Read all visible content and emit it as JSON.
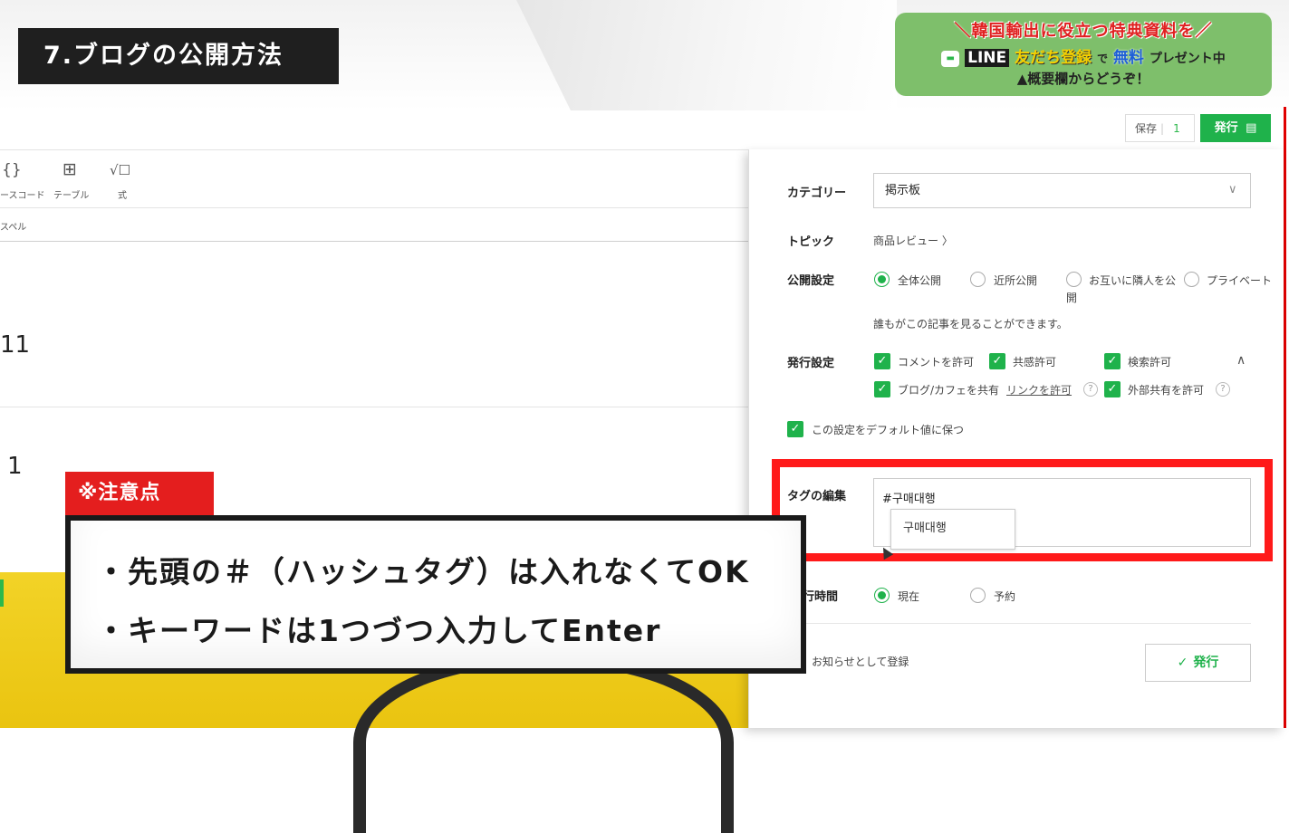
{
  "banner": {
    "section_title": "7.ブログの公開方法",
    "promo_line1": "＼韓国輸出に役立つ特典資料を／",
    "promo_line_word": "LINE",
    "promo_friends": "友だち登録",
    "promo_de": "で",
    "promo_free": "無料",
    "promo_present": "プレゼント中",
    "promo_line3": "▲概要欄からどうぞ！"
  },
  "toolbar": {
    "source_code_icon": "{}",
    "source_code_label": "ースコード",
    "table_icon": "⊞",
    "table_label": "テーブル",
    "formula_icon": "√☐",
    "formula_label": "式",
    "spell_label": "スペル"
  },
  "editor": {
    "text_1": "11",
    "text_2": "1"
  },
  "top_actions": {
    "save_label": "保存",
    "save_count": "1",
    "publish_label": "発行",
    "publish_icon": "▤"
  },
  "panel": {
    "category_label": "カテゴリー",
    "category_value": "掲示板",
    "topic_label": "トピック",
    "topic_value": "商品レビュー 〉",
    "visibility_label": "公開設定",
    "visibility_options": [
      "全体公開",
      "近所公開",
      "お互いに隣人を公開",
      "プライベート"
    ],
    "visibility_opt3_a": "お互いに隣人を公",
    "visibility_opt3_b": "開",
    "visibility_note": "誰もがこの記事を見ることができます。",
    "publish_settings_label": "発行設定",
    "allow_comments": "コメントを許可",
    "allow_likes": "共感許可",
    "allow_search": "検索許可",
    "share_blog_cafe": "ブログ/カフェを共有",
    "link_allow_select": "リンクを許可",
    "allow_external_share": "外部共有を許可",
    "keep_default": "この設定をデフォルト値に保つ",
    "tag_edit_label": "タグの編集",
    "tag_value": "#구매대행",
    "tag_suggestion": "구매대행",
    "publish_time_label": "行時間",
    "time_now": "現在",
    "time_reserve": "予約",
    "notice_register": "お知らせとして登録",
    "publish_button": "発行",
    "question_mark": "?",
    "collapse_icon": "∧",
    "select_chevron": "∨",
    "check_mark": "✓"
  },
  "caution": {
    "tag": "※注意点",
    "line1": "・先頭の＃（ハッシュタグ）は入れなくてOK",
    "line2": "・キーワードは1つづつ入力してEnter"
  },
  "colors": {
    "accent_green": "#1fb24b",
    "alert_red": "#e41e1e",
    "promo_green": "#7ebf6b",
    "yellow": "#f2d327"
  }
}
